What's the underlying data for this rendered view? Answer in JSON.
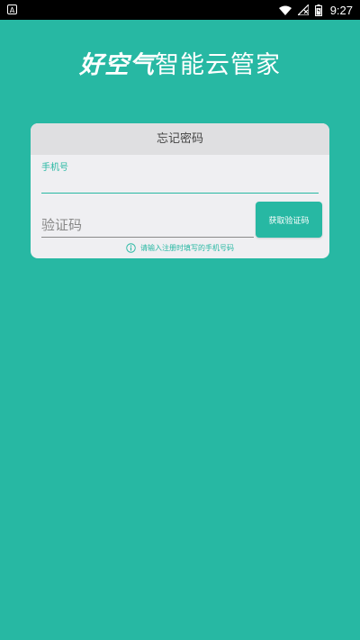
{
  "status_bar": {
    "left_icon": "A",
    "time": "9:27",
    "icons": [
      "wifi-icon",
      "signal-off-icon",
      "battery-icon"
    ]
  },
  "header": {
    "brand": "好空气",
    "subtitle": "智能云管家"
  },
  "form": {
    "title": "忘记密码",
    "phone_label": "手机号",
    "phone_value": "",
    "code_placeholder": "验证码",
    "code_value": "",
    "get_code_label": "获取验证码",
    "hint": "请输入注册时填写的手机号码"
  },
  "colors": {
    "background": "#27b8a3",
    "card": "#efeff2",
    "card_header": "#dfdfe1",
    "accent": "#27b8a3"
  }
}
